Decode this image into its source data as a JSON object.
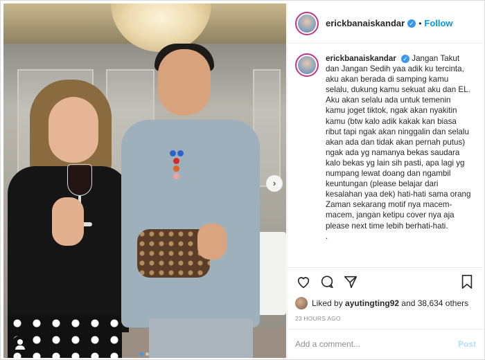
{
  "post": {
    "username": "erickbanaiskandar",
    "follow_label": "Follow",
    "caption": "Jangan Takut dan Jangan Sedih yaa adik ku tercinta, aku akan berada di samping kamu selalu, dukung kamu sekuat aku dan EL. Aku akan selalu ada untuk temenin kamu joget tiktok, ngak akan nyakitin kamu (btw kalo adik kakak kan biasa ribut tapi ngak akan ninggalin dan selalu akan ada dan tidak akan pernah putus) ngak ada yg namanya bekas saudara kalo bekas yg lain sih pasti, apa lagi yg numpang lewat doang dan ngambil keuntungan (please belajar dari kesalahan yaa dek) hati-hati sama orang Zaman sekarang motif nya macem-macem, jangan ketipu cover nya aja please next time lebih berhati-hati.",
    "caption_end": ".",
    "likes_prefix": "Liked by",
    "liked_by_user": "ayutingting92",
    "likes_suffix": "and 38,634 others",
    "timestamp": "23 HOURS AGO",
    "comment_placeholder": "Add a comment...",
    "post_label": "Post",
    "bullet": "•"
  },
  "icons": {
    "heart": "heart-icon",
    "comment": "comment-icon",
    "share": "share-icon",
    "bookmark": "bookmark-icon",
    "verified": "verified-icon",
    "next": "chevron-right-icon",
    "user_tag": "user-tag-icon"
  },
  "colors": {
    "accent": "#0095f6",
    "verified": "#3897f0",
    "muted": "#8e8e8e",
    "post_disabled": "#b2dffc"
  },
  "carousel": {
    "total": 2,
    "active_index": 0
  }
}
